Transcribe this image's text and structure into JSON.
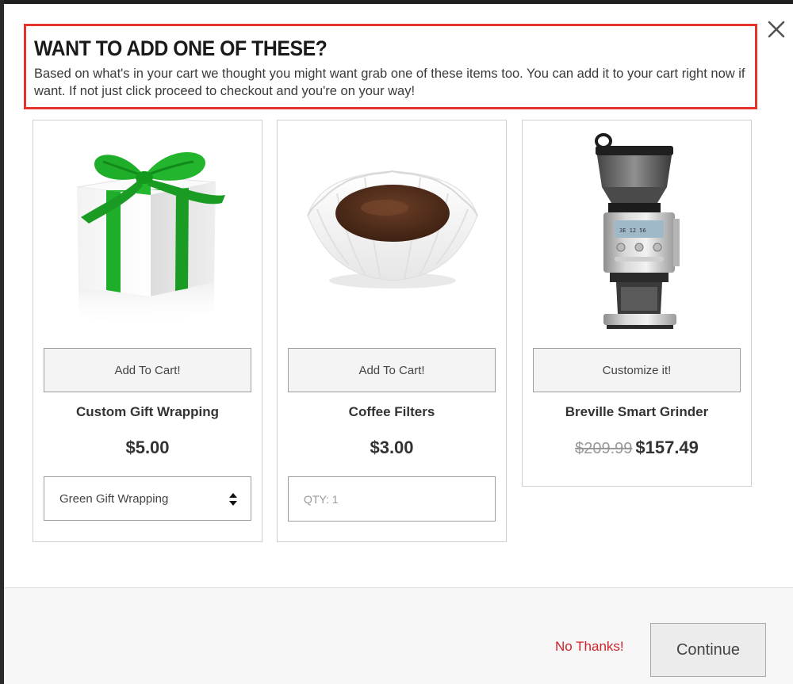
{
  "header": {
    "title": "WANT TO ADD ONE OF THESE?",
    "text": "Based on what's in your cart we thought you might want grab one of these items too. You can add it to your cart right now if want. If not just click proceed to checkout and you're on your way!"
  },
  "products": [
    {
      "name": "Custom Gift Wrapping",
      "button_label": "Add To Cart!",
      "price": "$5.00",
      "option_selected": "Green Gift Wrapping",
      "image_icon": "gift-box-icon"
    },
    {
      "name": "Coffee Filters",
      "button_label": "Add To Cart!",
      "price": "$3.00",
      "qty_placeholder": "QTY: 1",
      "image_icon": "coffee-filter-icon"
    },
    {
      "name": "Breville Smart Grinder",
      "button_label": "Customize it!",
      "old_price": "$209.99",
      "price": "$157.49",
      "image_icon": "coffee-grinder-icon"
    }
  ],
  "footer": {
    "decline_label": "No Thanks!",
    "continue_label": "Continue"
  },
  "colors": {
    "accent_red": "#e5352b",
    "decline_red": "#d0232a",
    "ribbon_green": "#1fae2a"
  }
}
